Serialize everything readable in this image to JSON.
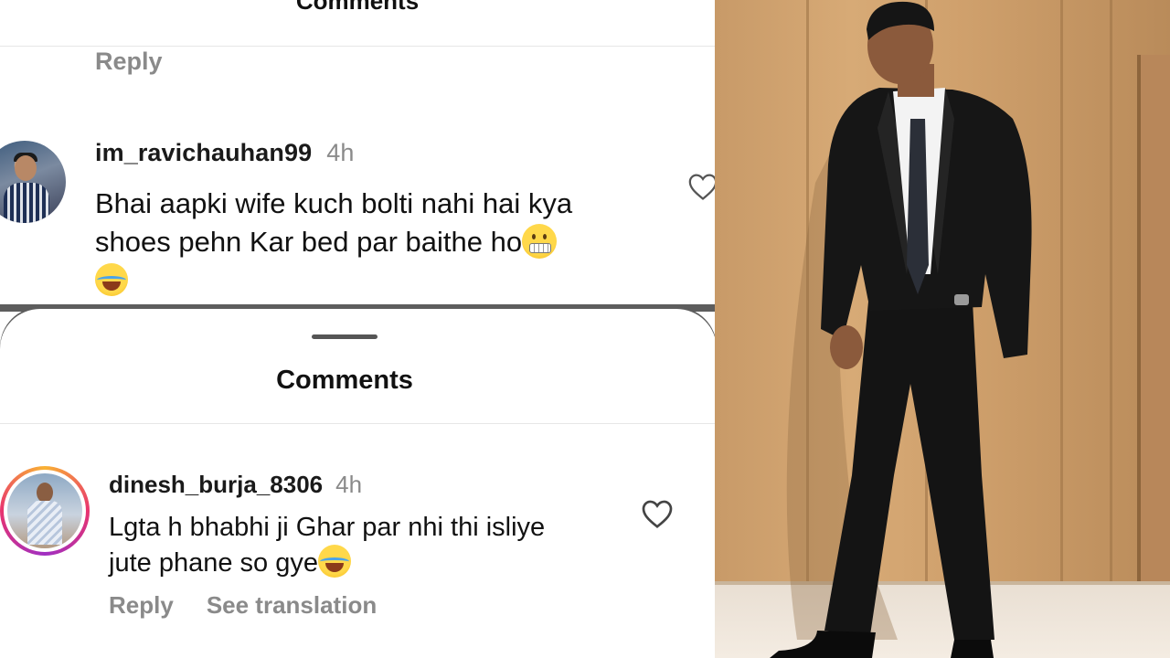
{
  "top_panel": {
    "title": "Comments",
    "reply_label": "Reply",
    "comment": {
      "username": "im_ravichauhan99",
      "time": "4h",
      "text_line1": "Bhai aapki wife kuch bolti nahi hai kya",
      "text_line2": "shoes pehn Kar bed par baithe ho",
      "emoji_inline": "grimacing-face",
      "emoji_trailing": "face-with-tears-of-joy"
    }
  },
  "bottom_panel": {
    "title": "Comments",
    "comment": {
      "username": "dinesh_burja_8306",
      "time": "4h",
      "text_line1": "Lgta h bhabhi ji Ghar par nhi thi isliye",
      "text_line2": "jute phane so gye",
      "emoji_inline": "face-with-tears-of-joy",
      "reply_label": "Reply",
      "translate_label": "See translation"
    }
  },
  "icons": {
    "like": "heart-outline-icon"
  },
  "colors": {
    "meta_gray": "#8a8a8a",
    "text": "#111111",
    "story_ring_start": "#f9b233",
    "story_ring_end": "#a02fc2"
  }
}
